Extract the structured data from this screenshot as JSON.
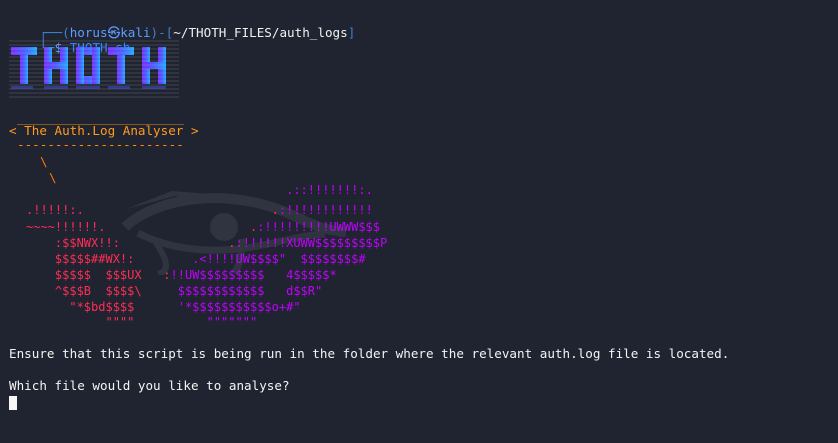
{
  "terminal": {
    "prompt": {
      "line1_prefix": "┌──(",
      "user": "horus",
      "symbol": "㉿",
      "host": "kali",
      "line1_mid": ")-[",
      "path": "~/THOTH_FILES/auth_logs",
      "line1_suffix": "]",
      "line2_prefix": "└─",
      "line2_symbol": "$",
      "command": "THOTH.sh"
    },
    "banner": {
      "logo_text": "THOTH"
    },
    "speech_bubble": {
      "top_border": "______________________",
      "title": "< The Auth.Log Analyser >",
      "bottom_border": "----------------------",
      "slash_1": "\\",
      "slash_2": "\\"
    },
    "art": {
      "lines": [
        "                                    .::!!!!!!!:.",
        ".!!!!!:.                          .:!!!!!!!!!!!!",
        "~~~~!!!!!!.                    .:!!!!!!!!!UWWW$$$",
        "    :$$NWX!!:               .:!!!!!!XUWW$$$$$$$$$P",
        "    $$$$$##WX!:        .<!!!!UW$$$$\"  $$$$$$$$#",
        "    $$$$$  $$$UX   :!!UW$$$$$$$$$   4$$$$$*",
        "    ^$$$B  $$$$\\     $$$$$$$$$$$$   d$$R\"",
        "      \"*$bd$$$$      '*$$$$$$$$$$$o+#\"",
        "           \"\"\"\"          \"\"\"\"\"\"\""
      ]
    },
    "messages": {
      "ensure": "Ensure that this script is being run in the folder where the relevant auth.log file is located.",
      "question": "Which file would you like to analyse?"
    },
    "colors": {
      "background": "#1f2430",
      "text": "#f4f4f4",
      "prompt_blue": "#2f7fff",
      "orange": "#ff8c00",
      "red": "#ff2d55",
      "purple": "#c000ff"
    }
  }
}
